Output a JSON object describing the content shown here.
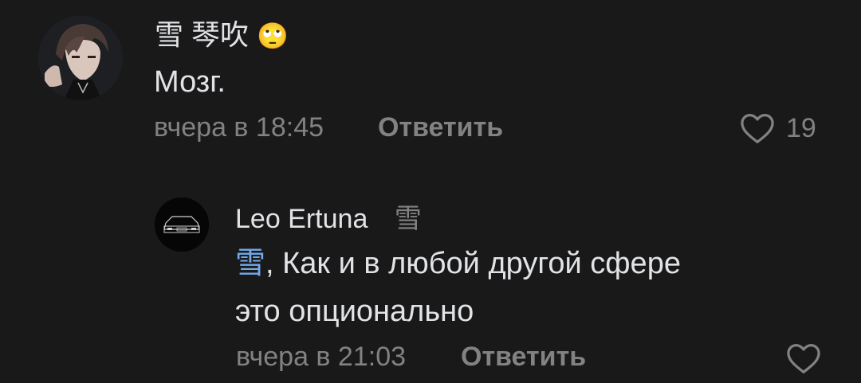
{
  "comments": [
    {
      "author": "雪 琴吹",
      "author_emoji": "🙄",
      "text": "Мозг.",
      "time": "вчера в 18:45",
      "reply_label": "Ответить",
      "likes": "19",
      "avatar_icon": "anime-avatar"
    },
    {
      "author": "Leo Ertuna",
      "reply_to": "雪",
      "mention": "雪",
      "text_line1": ", Как и в любой другой сфере",
      "text_line2": "это опционально",
      "time": "вчера в 21:03",
      "reply_label": "Ответить",
      "likes": "",
      "avatar_icon": "car-avatar"
    }
  ],
  "colors": {
    "background": "#19191a",
    "text": "#e1e3e6",
    "secondary": "#828282",
    "mention": "#71aaeb"
  }
}
